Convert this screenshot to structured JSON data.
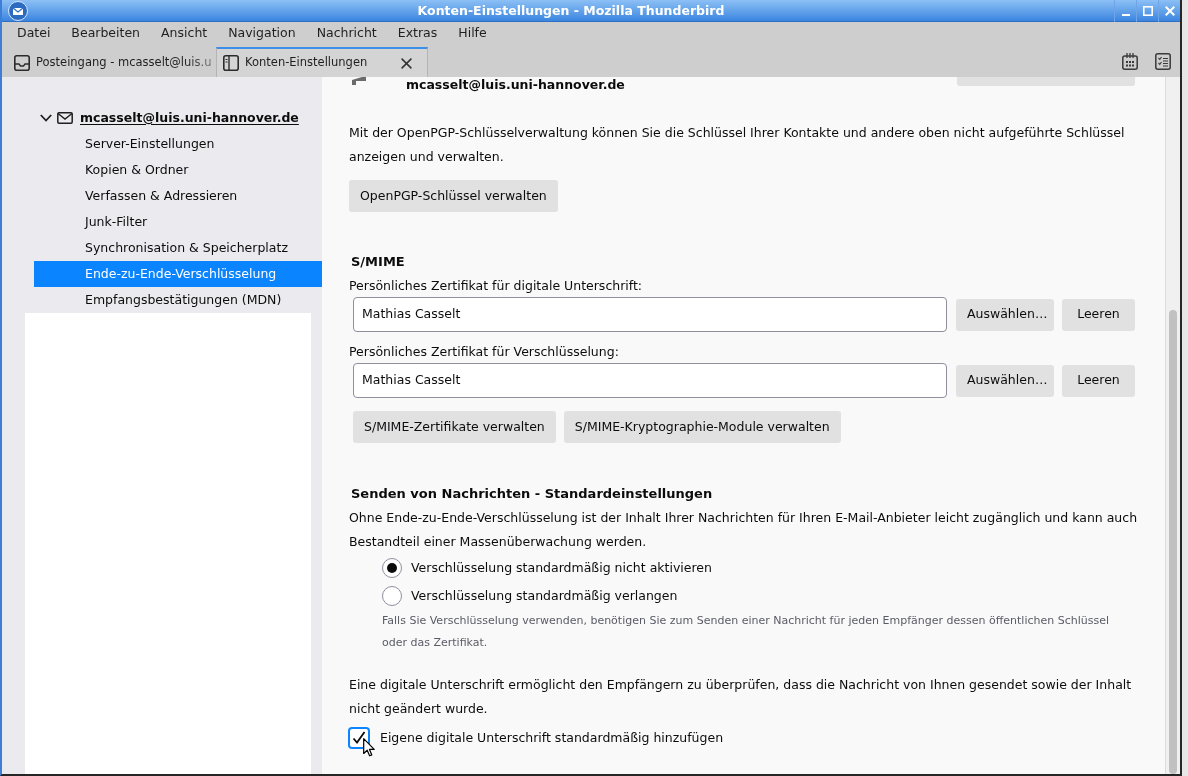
{
  "window": {
    "title": "Konten-Einstellungen - Mozilla Thunderbird"
  },
  "menu_bar": [
    {
      "label": "Datei"
    },
    {
      "label": "Bearbeiten"
    },
    {
      "label": "Ansicht"
    },
    {
      "label": "Navigation"
    },
    {
      "label": "Nachricht"
    },
    {
      "label": "Extras"
    },
    {
      "label": "Hilfe"
    }
  ],
  "tabs": [
    {
      "kind": "inbox",
      "label": "Posteingang - mcasselt@luis.u",
      "selected": false,
      "closable": false
    },
    {
      "kind": "settings",
      "label": "Konten-Einstellungen",
      "selected": true,
      "closable": true
    }
  ],
  "sidebar": {
    "account": {
      "label": "mcasselt@luis.uni-hannover.de",
      "expanded": true,
      "children": [
        {
          "label": "Server-Einstellungen",
          "selected": false
        },
        {
          "label": "Kopien & Ordner",
          "selected": false
        },
        {
          "label": "Verfassen & Adressieren",
          "selected": false
        },
        {
          "label": "Junk-Filter",
          "selected": false
        },
        {
          "label": "Synchronisation & Speicherplatz",
          "selected": false
        },
        {
          "label": "Ende-zu-Ende-Verschlüsselung",
          "selected": true
        },
        {
          "label": "Empfangsbestätigungen (MDN)",
          "selected": false
        }
      ]
    }
  },
  "content": {
    "key_row": {
      "label": "mcasselt@luis.uni-hannover.de"
    },
    "openpgp": {
      "text": "Mit der OpenPGP-Schlüsselverwaltung können Sie die Schlüssel Ihrer Kontakte und andere oben nicht aufgeführte Schlüssel anzeigen und verwalten.",
      "button": {
        "label": "OpenPGP-Schlüssel verwalten"
      }
    },
    "smime": {
      "heading": "S/MIME",
      "certificates": [
        {
          "label": "Persönliches Zertifikat für digitale Unterschrift:",
          "value": "Mathias Casselt",
          "buttons": [
            {
              "label": "Auswählen…"
            },
            {
              "label": "Leeren"
            }
          ]
        },
        {
          "label": "Persönliches Zertifikat für Verschlüsselung:",
          "value": "Mathias Casselt",
          "buttons": [
            {
              "label": "Auswählen…"
            },
            {
              "label": "Leeren"
            }
          ]
        }
      ],
      "buttons": [
        {
          "label": "S/MIME-Zertifikate verwalten"
        },
        {
          "label": "S/MIME-Kryptographie-Module verwalten"
        }
      ]
    },
    "sending": {
      "heading": "Senden von Nachrichten - Standardeinstellungen",
      "text": "Ohne Ende-zu-Ende-Verschlüsselung ist der Inhalt Ihrer Nachrichten für Ihren E-Mail-Anbieter leicht zugänglich und kann auch Bestandteil einer Massenüberwachung werden.",
      "options": [
        {
          "label": "Verschlüsselung standardmäßig nicht aktivieren",
          "selected": true
        },
        {
          "label": "Verschlüsselung standardmäßig verlangen",
          "selected": false
        }
      ],
      "note": "Falls Sie Verschlüsselung verwenden, benötigen Sie zum Senden einer Nachricht für jeden Empfänger dessen öffentlichen Schlüssel oder das Zertifikat.",
      "signature_text": "Eine digitale Unterschrift ermöglicht den Empfängern zu überprüfen, dass die Nachricht von Ihnen gesendet sowie der Inhalt nicht geändert wurde.",
      "signature_checkbox": {
        "label": "Eigene digitale Unterschrift standardmäßig hinzufügen",
        "checked": true,
        "focused": true
      }
    }
  }
}
